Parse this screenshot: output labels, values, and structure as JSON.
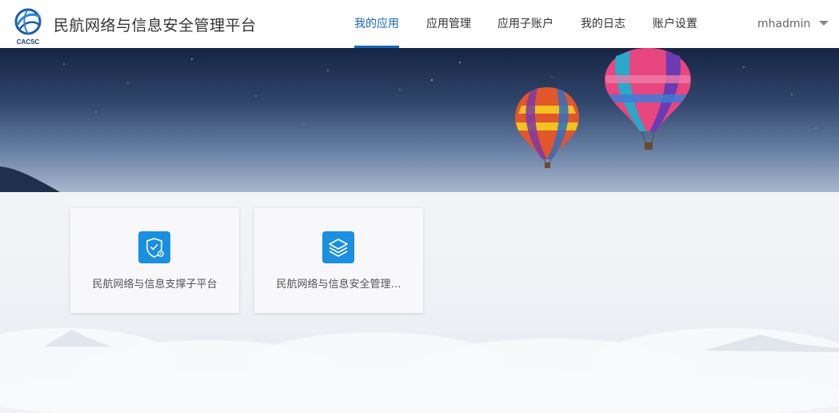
{
  "header": {
    "logo_text": "CACSC",
    "title": "民航网络与信息安全管理平台"
  },
  "nav": {
    "items": [
      {
        "label": "我的应用",
        "active": true
      },
      {
        "label": "应用管理",
        "active": false
      },
      {
        "label": "应用子账户",
        "active": false
      },
      {
        "label": "我的日志",
        "active": false
      },
      {
        "label": "账户设置",
        "active": false
      }
    ]
  },
  "user": {
    "name": "mhadmin",
    "menu_icon": "caret-down-icon"
  },
  "apps": [
    {
      "label": "民航网络与信息支撑子平台",
      "icon": "shield-gear-icon"
    },
    {
      "label": "民航网络与信息安全管理…",
      "icon": "layers-icon"
    }
  ],
  "colors": {
    "accent": "#1469b8",
    "app_icon_bg": "#1b8fe0",
    "header_bg": "#ffffff"
  }
}
